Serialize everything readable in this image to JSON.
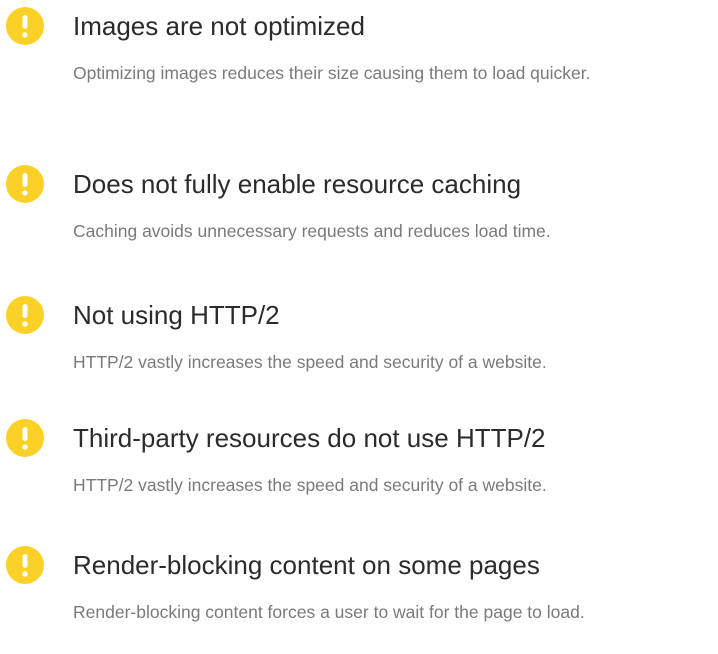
{
  "colors": {
    "badge": "#fbd128",
    "badge_mark": "#ffffff",
    "title": "#2b2b2b",
    "description": "#7a7a7a"
  },
  "issues": [
    {
      "icon": "warning-icon",
      "title": "Images are not optimized",
      "description": "Optimizing images reduces their size causing them to load quicker."
    },
    {
      "icon": "warning-icon",
      "title": "Does not fully enable resource caching",
      "description": "Caching avoids unnecessary requests and reduces load time."
    },
    {
      "icon": "warning-icon",
      "title": "Not using HTTP/2",
      "description": "HTTP/2 vastly increases the speed and security of a website."
    },
    {
      "icon": "warning-icon",
      "title": "Third-party resources do not use HTTP/2",
      "description": "HTTP/2 vastly increases the speed and security of a website."
    },
    {
      "icon": "warning-icon",
      "title": "Render-blocking content on some pages",
      "description": "Render-blocking content forces a user to wait for the page to load."
    }
  ]
}
